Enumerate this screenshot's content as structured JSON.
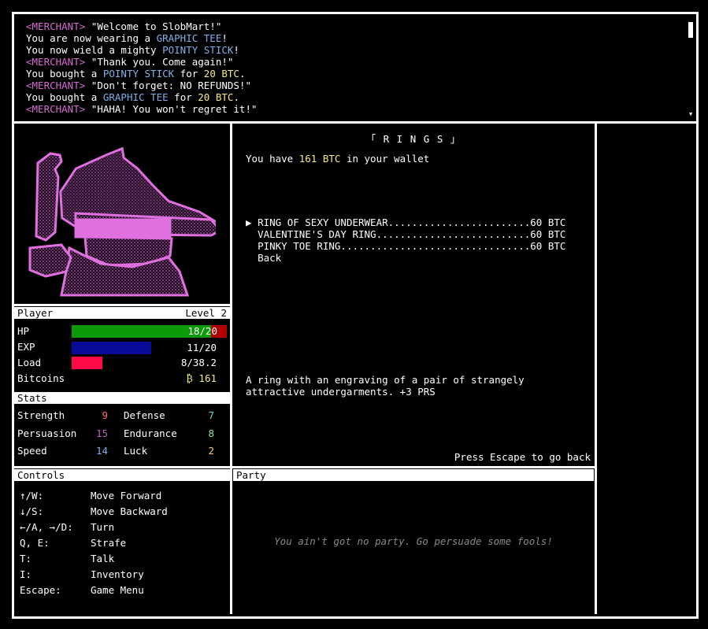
{
  "colors": {
    "merchant": "#d46ad0",
    "item": "#7fb1e8",
    "money": "#f5e98a",
    "hp_bar": "#0a9a0a",
    "hp_missing": "#b30000",
    "exp_bar": "#0a0a9a",
    "load_bar": "#ff0a46"
  },
  "log": [
    {
      "id": "l0",
      "parts": [
        {
          "t": "<MERCHANT>",
          "c": "merchant"
        },
        {
          "t": " \"Welcome to SlobMart!\""
        }
      ]
    },
    {
      "id": "l1",
      "parts": [
        {
          "t": "You are now wearing a "
        },
        {
          "t": "GRAPHIC TEE",
          "c": "item"
        },
        {
          "t": "!"
        }
      ]
    },
    {
      "id": "l2",
      "parts": [
        {
          "t": "You now wield a mighty "
        },
        {
          "t": "POINTY STICK",
          "c": "item"
        },
        {
          "t": "!"
        }
      ]
    },
    {
      "id": "l3",
      "parts": [
        {
          "t": "<MERCHANT>",
          "c": "merchant"
        },
        {
          "t": " \"Thank you. Come again!\""
        }
      ]
    },
    {
      "id": "l4",
      "parts": [
        {
          "t": "You bought a "
        },
        {
          "t": "POINTY STICK",
          "c": "item"
        },
        {
          "t": " for "
        },
        {
          "t": "20 BTC",
          "c": "money"
        },
        {
          "t": "."
        }
      ]
    },
    {
      "id": "l5",
      "parts": [
        {
          "t": "<MERCHANT>",
          "c": "merchant"
        },
        {
          "t": " \"Don't forget: NO REFUNDS!\""
        }
      ]
    },
    {
      "id": "l6",
      "parts": [
        {
          "t": "You bought a "
        },
        {
          "t": "GRAPHIC TEE",
          "c": "item"
        },
        {
          "t": " for "
        },
        {
          "t": "20 BTC",
          "c": "money"
        },
        {
          "t": "."
        }
      ]
    },
    {
      "id": "l7",
      "parts": [
        {
          "t": "<MERCHANT>",
          "c": "merchant"
        },
        {
          "t": " \"HAHA! You won't regret it!\""
        }
      ]
    }
  ],
  "player": {
    "header": "Player",
    "level": "Level 2",
    "hp_label": "HP",
    "hp_value": "18/20",
    "hp_fraction": 0.9,
    "exp_label": "EXP",
    "exp_value": "11/20",
    "exp_fraction": 0.55,
    "load_label": "Load",
    "load_value": "8/38.2",
    "load_fraction": 0.21,
    "bitcoins_label": "Bitcoins",
    "bitcoins_value": "₿ 161"
  },
  "stats": {
    "header": "Stats",
    "items": [
      {
        "label": "Strength",
        "value": "9",
        "color": "#ff6b6b"
      },
      {
        "label": "Defense",
        "value": "7",
        "color": "#6ad4d4"
      },
      {
        "label": "Persuasion",
        "value": "15",
        "color": "#c05fc0"
      },
      {
        "label": "Endurance",
        "value": "8",
        "color": "#9ae29a"
      },
      {
        "label": "Speed",
        "value": "14",
        "color": "#7fb1e8"
      },
      {
        "label": "Luck",
        "value": "2",
        "color": "#f5c97a"
      }
    ]
  },
  "shop": {
    "title": "「 R I N G S 」",
    "wallet_pre": "You have ",
    "wallet_amount": "161 BTC",
    "wallet_post": " in your wallet",
    "cursor": "▶",
    "items": [
      {
        "label": "RING OF SEXY UNDERWEAR........................60 BTC",
        "selected": true
      },
      {
        "label": "VALENTINE'S DAY RING..........................60 BTC",
        "selected": false
      },
      {
        "label": "PINKY TOE RING................................60 BTC",
        "selected": false
      },
      {
        "label": "Back",
        "selected": false
      }
    ],
    "description_line1": "A ring with an engraving of a pair of strangely",
    "description_line2": "attractive undergarments. +3 PRS",
    "escape_hint": "Press Escape to go back"
  },
  "controls": {
    "header": "Controls",
    "rows": [
      {
        "key": "↑/W:",
        "action": "Move Forward"
      },
      {
        "key": "↓/S:",
        "action": "Move Backward"
      },
      {
        "key": "←/A, →/D:",
        "action": "Turn"
      },
      {
        "key": "Q, E:",
        "action": "Strafe"
      },
      {
        "key": "T:",
        "action": "Talk"
      },
      {
        "key": "I:",
        "action": "Inventory"
      },
      {
        "key": "Escape:",
        "action": "Game Menu"
      }
    ]
  },
  "party": {
    "header": "Party",
    "empty_text": "You ain't got no party. Go persuade some fools!"
  }
}
